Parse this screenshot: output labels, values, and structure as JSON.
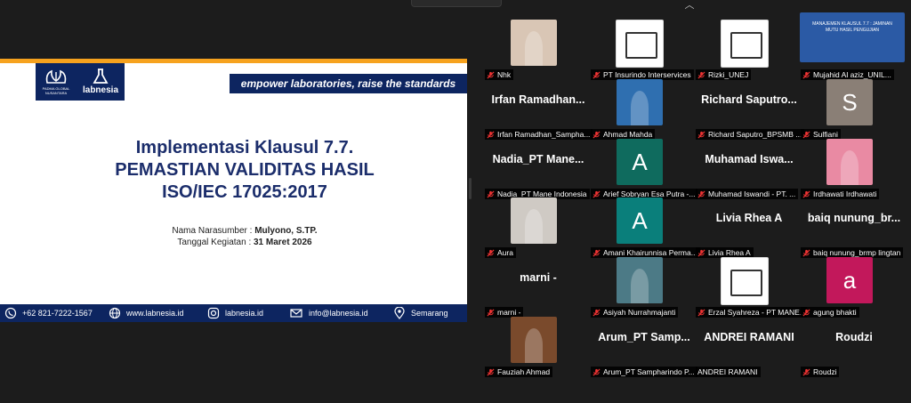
{
  "slide": {
    "logo_left_text": "PADMA GLOBAL NUSANTARA",
    "logo_right_text": "labnesia",
    "tagline": "empower laboratories, raise the standards",
    "title_line1": "Implementasi Klausul 7.7.",
    "title_line2": "PEMASTIAN VALIDITAS HASIL",
    "title_line3": "ISO/IEC 17025:2017",
    "speaker_label": "Nama Narasumber : ",
    "speaker_value": "Mulyono, S.TP.",
    "date_label": "Tanggal Kegiatan : ",
    "date_value": "31 Maret 2026",
    "footer": {
      "phone": "+62 821-7222-1567",
      "web": "www.labnesia.id",
      "instagram": "labnesia.id",
      "email": "info@labnesia.id",
      "location": "Semarang"
    }
  },
  "participants": [
    {
      "label": "Nhk",
      "kind": "photo",
      "color": "#d9c6b5"
    },
    {
      "label": "PT Insurindo Interservices",
      "kind": "logo",
      "color": "#1f5fb3"
    },
    {
      "label": "Rizki_UNEJ",
      "kind": "logo",
      "color": "#e8c36a"
    },
    {
      "label": "Mujahid Al aziz_UNIL...",
      "kind": "slide",
      "color": "#2b5aa5",
      "mini": "MANAJEMEN KLAUSUL 7.7 : JAMINAN MUTU HASIL PENGUJIAN"
    },
    {
      "label": "Irfan Ramadhan_Sampha...",
      "kind": "name",
      "big": "Irfan  Ramadhan..."
    },
    {
      "label": "Ahmad Mahda",
      "kind": "photo",
      "color": "#2f6fb0"
    },
    {
      "label": "Richard Saputro_BPSMB ...",
      "kind": "name",
      "big": "Richard  Saputro..."
    },
    {
      "label": "Sulfiani",
      "kind": "letter",
      "letter": "S",
      "color": "#8a7f76"
    },
    {
      "label": "Nadia_PT Mane Indonesia",
      "kind": "name",
      "big": "Nadia_PT  Mane..."
    },
    {
      "label": "Arief Sobryan Esa Putra -...",
      "kind": "letter",
      "letter": "A",
      "color": "#0f6b5e"
    },
    {
      "label": "Muhamad Iswandi - PT. ...",
      "kind": "name",
      "big": "Muhamad  Iswa..."
    },
    {
      "label": "Irdhawati Irdhawati",
      "kind": "photo",
      "color": "#e98aa3"
    },
    {
      "label": "Aura",
      "kind": "photo",
      "color": "#cfcac4"
    },
    {
      "label": "Amani Khairunnisa Perma...",
      "kind": "letter",
      "letter": "A",
      "color": "#0a7f7b"
    },
    {
      "label": "Livia Rhea A",
      "kind": "name",
      "big": "Livia Rhea A"
    },
    {
      "label": "baiq nunung_brmp lingtan",
      "kind": "name",
      "big": "baiq nunung_br..."
    },
    {
      "label": "marni -",
      "kind": "name",
      "big": "marni -"
    },
    {
      "label": "Asiyah Nurrahmajanti",
      "kind": "photo",
      "color": "#4c7a86"
    },
    {
      "label": "Erzal Syahreza - PT MANE...",
      "kind": "logo",
      "color": "#f4f4f4"
    },
    {
      "label": "agung bhakti",
      "kind": "letter",
      "letter": "a",
      "color": "#c2185b"
    },
    {
      "label": "Fauziah Ahmad",
      "kind": "photo",
      "color": "#7a4a2c"
    },
    {
      "label": "Arum_PT Sampharindo P...",
      "kind": "name",
      "big": "Arum_PT  Samp..."
    },
    {
      "label": "ANDREI RAMANI",
      "kind": "name",
      "big": "ANDREI RAMANI",
      "nomic": true
    },
    {
      "label": "Roudzi",
      "kind": "name",
      "big": "Roudzi"
    }
  ]
}
